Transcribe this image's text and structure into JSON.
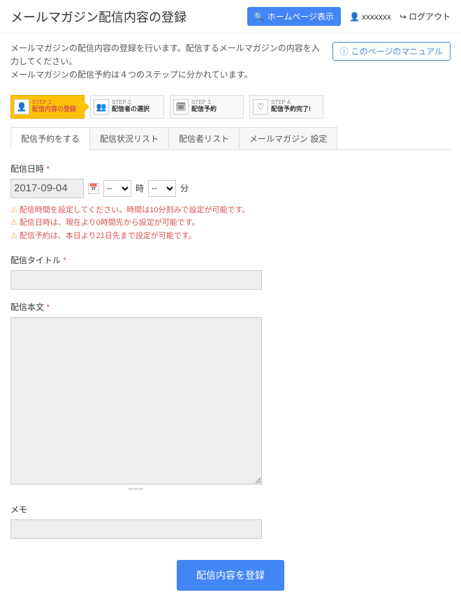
{
  "header": {
    "title": "メールマガジン配信内容の登録",
    "homepage_btn": "ホームページ表示",
    "username": "xxxxxxx",
    "logout": "ログアウト"
  },
  "description": {
    "line1": "メールマガジンの配信内容の登録を行います。配信するメールマガジンの内容を入力してください。",
    "line2": "メールマガジンの配信予約は４つのステップに分かれています。"
  },
  "manual_btn": "このページのマニュアル",
  "steps": [
    {
      "num": "STEP 1.",
      "label": "配信内容の登録",
      "icon": "👤"
    },
    {
      "num": "STEP 2.",
      "label": "配信者の選択",
      "icon": "👥"
    },
    {
      "num": "STEP 3.",
      "label": "配信予約",
      "icon": "🗓"
    },
    {
      "num": "STEP 4.",
      "label": "配信予約完了!",
      "icon": "♡"
    }
  ],
  "tabs": [
    "配信予約をする",
    "配信状況リスト",
    "配信者リスト",
    "メールマガジン 設定"
  ],
  "form": {
    "date_label": "配信日時",
    "date_value": "2017-09-04",
    "hour_placeholder": "--",
    "hour_suffix": "時",
    "minute_placeholder": "--",
    "minute_suffix": "分",
    "warnings": [
      "配信時間を設定してください。時間は10分刻みで設定が可能です。",
      "配信日時は、現在より0時間先から設定が可能です。",
      "配信予約は、本日より21日先まで設定が可能です。"
    ],
    "title_label": "配信タイトル",
    "body_label": "配信本文",
    "memo_label": "メモ",
    "submit": "配信内容を登録"
  }
}
